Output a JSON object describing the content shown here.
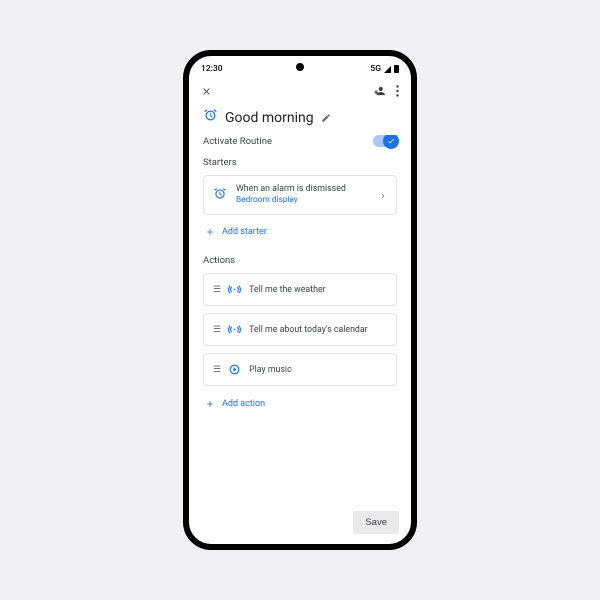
{
  "status": {
    "time": "12:30",
    "net": "5G"
  },
  "title": "Good morning",
  "activate": {
    "label": "Activate Routine",
    "on": true
  },
  "starters": {
    "heading": "Starters",
    "items": [
      {
        "title": "When an alarm is dismissed",
        "sub": "Bedroom display"
      }
    ],
    "add_label": "Add starter"
  },
  "actions": {
    "heading": "Actions",
    "items": [
      {
        "icon": "speak",
        "label": "Tell me the weather"
      },
      {
        "icon": "speak",
        "label": "Tell me about today's calendar"
      },
      {
        "icon": "play",
        "label": "Play music"
      }
    ],
    "add_label": "Add action"
  },
  "footer": {
    "save": "Save"
  }
}
